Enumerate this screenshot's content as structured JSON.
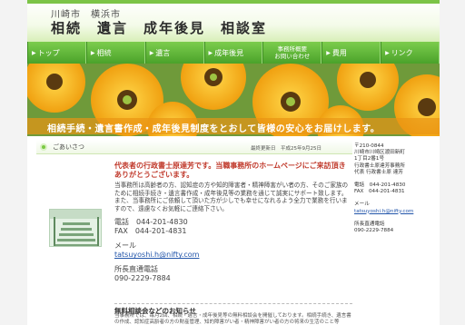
{
  "header": {
    "city": "川崎市　横浜市",
    "title": "相続　遺言　成年後見　相談室"
  },
  "nav": {
    "items": [
      {
        "label": "トップ",
        "arrow": "▶"
      },
      {
        "label": "相続",
        "arrow": "▶"
      },
      {
        "label": "遺言",
        "arrow": "▶"
      },
      {
        "label": "成年後見",
        "arrow": "▶"
      },
      {
        "label": "事務所概要",
        "label2": "お問い合わせ"
      },
      {
        "label": "費用",
        "arrow": "▶"
      },
      {
        "label": "リンク",
        "arrow": "▶"
      }
    ]
  },
  "banner": {
    "tagline": "相続手続・遺言書作成・成年後見制度をとおして皆様の安心をお届けします。"
  },
  "section": {
    "title": "ごあいさつ",
    "updated": "最終更新日　平成25年9月25日"
  },
  "greeting": {
    "lead": "代表者の行政書士原達芳です。当職事務所のホームページにご来訪頂きありがとうございます。",
    "body": "当事務所は高齢者の方、認知症の方や知的障害者・精神障害がい者の方、そのご家族のために相続手続き・遺言書作成・成年後見等の業務を通じて誠実にサポート致します。また、当事務所にご依頼して頂いた方が少しでも幸せになれるよう全力で業務を行いますので、遠慮なくお気軽にご連絡下さい。",
    "tel": "電話　044-201-4830",
    "fax": "FAX　044-201-4831",
    "mail_label": "メール",
    "mail": "tatsuyoshi.h@nifty.com",
    "mobile_label": "所長直通電話",
    "mobile": "090-2229-7884"
  },
  "news": {
    "title": "無料相談会などのお知らせ",
    "text": "当事務所では、毎月2回、相続・遺言・成年後見等の無料相談会を開催しております。相続手続き、遺言書の作成、認知症高齢者の方の財産管理、知的障害がい者・精神障害がい者の方の将来の生活のこと等"
  },
  "sidebar": {
    "address1": "〒210-0844",
    "address2": "川崎市川崎区渡田新町",
    "address3": "1丁目2番1号",
    "office": "行政書士原達芳事務所",
    "rep": "代表 行政書士原 達芳",
    "tel": "電話　044-201-4830",
    "fax": "FAX　044-201-4831",
    "mail_label": "メール",
    "mail": "tatsuyoshi.h@nifty.com",
    "mobile_label": "所長直通電話",
    "mobile": "090-2229-7884"
  },
  "colors": {
    "nav_green": "#4aa22a",
    "accent_red": "#c0392b",
    "link_blue": "#2255aa",
    "banner_orange": "#e99414"
  }
}
